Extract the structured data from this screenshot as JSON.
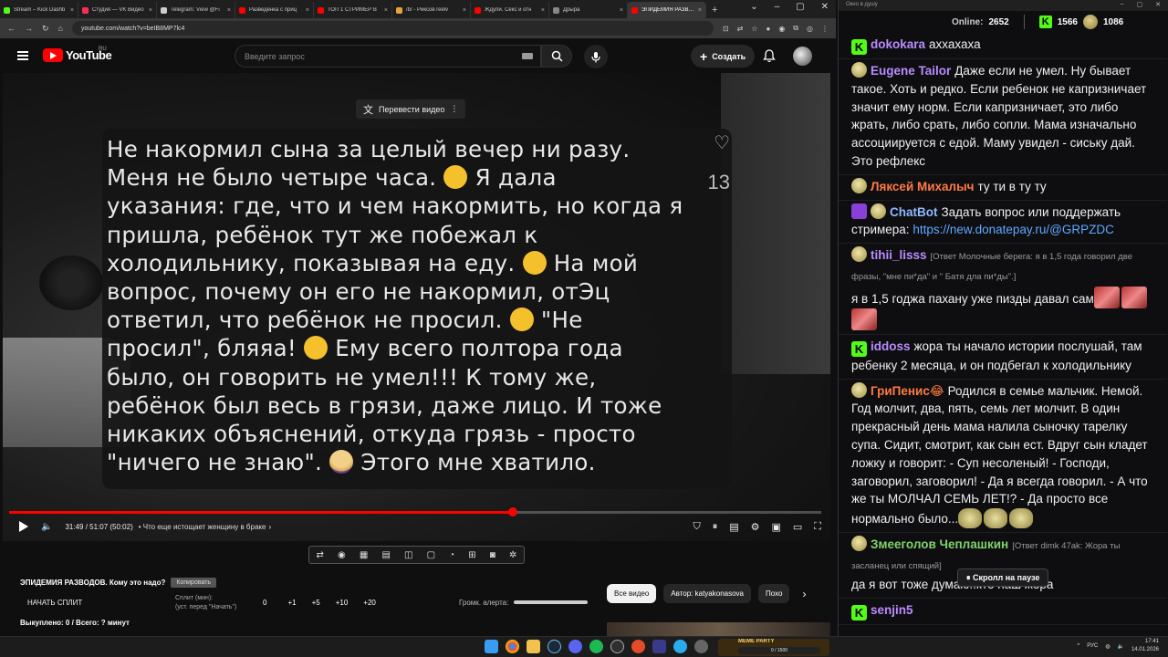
{
  "browser": {
    "tabs": [
      {
        "label": "Stream – Kick Dashb",
        "color": "#53fc18"
      },
      {
        "label": "Студия — VK Видео",
        "color": "#ff2d55"
      },
      {
        "label": "Telegram: View @Fi",
        "color": "#cccccc"
      },
      {
        "label": "Разведёнка с приц",
        "color": "#ff0000"
      },
      {
        "label": "ТОП 1 СТРИМЕР В",
        "color": "#ff0000"
      },
      {
        "label": "/b/ - Рикcoв reelv",
        "color": "#e8a33d"
      },
      {
        "label": "Ждули. Секс и отн",
        "color": "#ff0000"
      },
      {
        "label": "Дрыра",
        "color": "#888888"
      },
      {
        "label": "ЭПИДЕМИЯ РАЗВОД",
        "color": "#ff0000",
        "active": true
      }
    ],
    "url": "youtube.com/watch?v=beIB8MP7lc4"
  },
  "youtube": {
    "logo_text": "YouTube",
    "region": "RU",
    "search_placeholder": "Введите запрос",
    "create_label": "Создать",
    "translate_label": "Перевести видео",
    "story_lines": [
      "Не накормил сына за целый вечер ни разу.",
      "Меня не было четыре часа.",
      "Я дала",
      "указания: где, что и чем накормить, но когда я",
      "пришла, ребёнок тут же побежал к",
      "холодильнику, показывая на еду.",
      "На мой",
      "вопрос, почему он его не накормил, отЭц",
      "ответил, что ребёнок не просил.",
      "\"Не",
      "просил\", бляяа!",
      "Ему всего полтора года",
      "было, он говорить не умел!!! К тому же,",
      "ребёнок был весь в грязи, даже лицо. И тоже",
      "никаких объяснений, откуда грязь - просто",
      "\"ничего не знаю\".",
      "Этого мне хватило."
    ],
    "story_count": "13",
    "progress": 0.62,
    "time": "31:49 / 51:07 (50:02)",
    "chapter": "• Что еще истощает женщину в браке",
    "chips": [
      "Все видео",
      "Автор: katyakonasova",
      "Похо"
    ]
  },
  "split": {
    "title": "ЭПИДЕМИЯ РАЗВОДОВ. Кому это надо?",
    "copy_label": "Копировать",
    "start_label": "НАЧАТЬ СПЛИТ",
    "split_min_label": "Сплит (мин):",
    "split_min_hint": "(уст. перед \"Начать\")",
    "values": [
      "0",
      "+1",
      "+5",
      "+10",
      "+20"
    ],
    "alert_label": "Громк. алерта:",
    "outcome": "Выкуплено: 0 / Всего: ? минут"
  },
  "chat": {
    "window_title": "Окно в душу",
    "online_label": "Online:",
    "online_value": "2652",
    "kick_count": "1566",
    "coin_count": "1086",
    "messages": [
      {
        "badges": [
          "k"
        ],
        "nick": "dokokara",
        "color": "#b98cff",
        "text": "аххахаха"
      },
      {
        "badges": [
          "coin"
        ],
        "nick": "Eugene Tailor",
        "color": "#b98cff",
        "text": "Даже если не умел. Ну бывает такое. Хоть и редко. Если ребенок не капризничает значит ему норм. Если капризничает, это либо жрать, либо срать, либо сопли. Мама изначально ассоциируется с едой. Маму увидел - сиську дай. Это рефлекс"
      },
      {
        "badges": [
          "coin"
        ],
        "nick": "Ляксей Михалыч",
        "color": "#ff7a45",
        "text": "ту ти в ту ту"
      },
      {
        "badges": [
          "bot",
          "coin"
        ],
        "nick": "ChatBot",
        "color": "#8fb8ff",
        "text": "Задать вопрос или поддержать стримера:",
        "link": "https://new.donatepay.ru/@GRPZDC"
      },
      {
        "badges": [
          "coin"
        ],
        "nick": "tihii_lisss",
        "color": "#b98cff",
        "reply": "[Ответ Молочные берега: я в 1,5 года говорил две фразы, \"мне пи*да\" и \" Батя дла пи*ды\".]",
        "text": "я в 1,5 годжа пахану уже пизды давал сам"
      },
      {
        "badges": [
          "k"
        ],
        "nick": "iddoss",
        "color": "#b98cff",
        "text": "жора ты начало истории послушай, там ребенку 2 месяца, и он подбегал к холодильнику"
      },
      {
        "badges": [
          "coin"
        ],
        "nick": "ГриПенис😂",
        "color": "#ff7a45",
        "text": "Родился в семье мальчик. Немой. Год молчит, два, пять, семь лет молчит. В один прекрасный день мама налила сыночку тарелку супа. Сидит, смотрит, как сын ест. Вдруг сын кладет ложку и говорит: - Суп несоленый! - Господи, заговорил, заговорил! - Да я всегда говорил. - А что же ты МОЛЧАЛ СЕМЬ ЛЕТ!? - Да просто все нормально было..."
      },
      {
        "badges": [
          "coin"
        ],
        "nick": "Змееголов Чеплашкин",
        "color": "#7fd36a",
        "reply": "[Ответ dimk 47ak: Жора ты засланец или спящий]",
        "text": "да я вот тоже думаю..кто наш жора"
      },
      {
        "badges": [
          "k"
        ],
        "nick": "senjin5",
        "color": "#b98cff",
        "text": ""
      }
    ],
    "paused_label": "⏸ Скролл на паузе"
  },
  "taskbar": {
    "widget_label": "MEME PARTY",
    "widget_value": "0 / 1500",
    "lang": "РУС",
    "time": "17:41",
    "date": "14.01.2026"
  }
}
